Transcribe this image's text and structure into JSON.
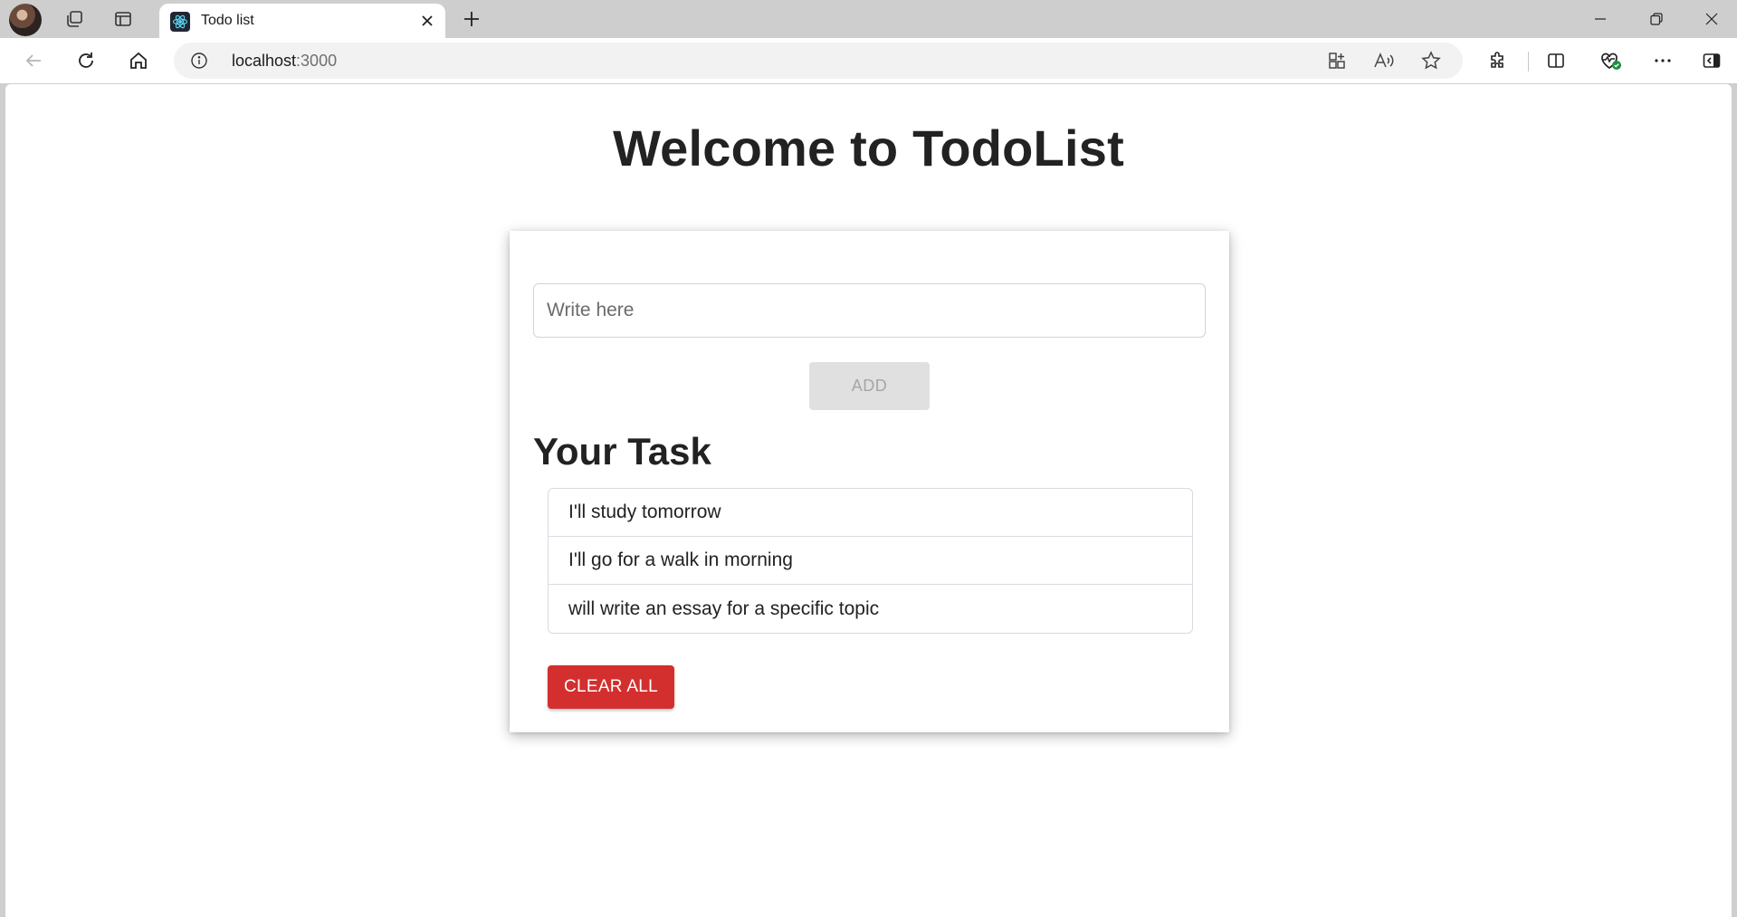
{
  "browser": {
    "tab": {
      "title": "Todo list",
      "favicon": "react-logo-icon"
    },
    "address": {
      "host": "localhost",
      "port": ":3000"
    },
    "colors": {
      "tabstrip": "#cecece",
      "toolbar": "#ffffff"
    }
  },
  "app": {
    "heading": "Welcome to TodoList",
    "input": {
      "placeholder": "Write here",
      "value": ""
    },
    "add_label": "ADD",
    "section_title": "Your Task",
    "tasks": [
      "I'll study tomorrow",
      "I'll go for a walk in morning",
      "will write an essay for a specific topic"
    ],
    "clear_label": "CLEAR ALL",
    "colors": {
      "clear_button": "#d32f2f",
      "add_button_disabled": "#e0e0e0"
    }
  }
}
